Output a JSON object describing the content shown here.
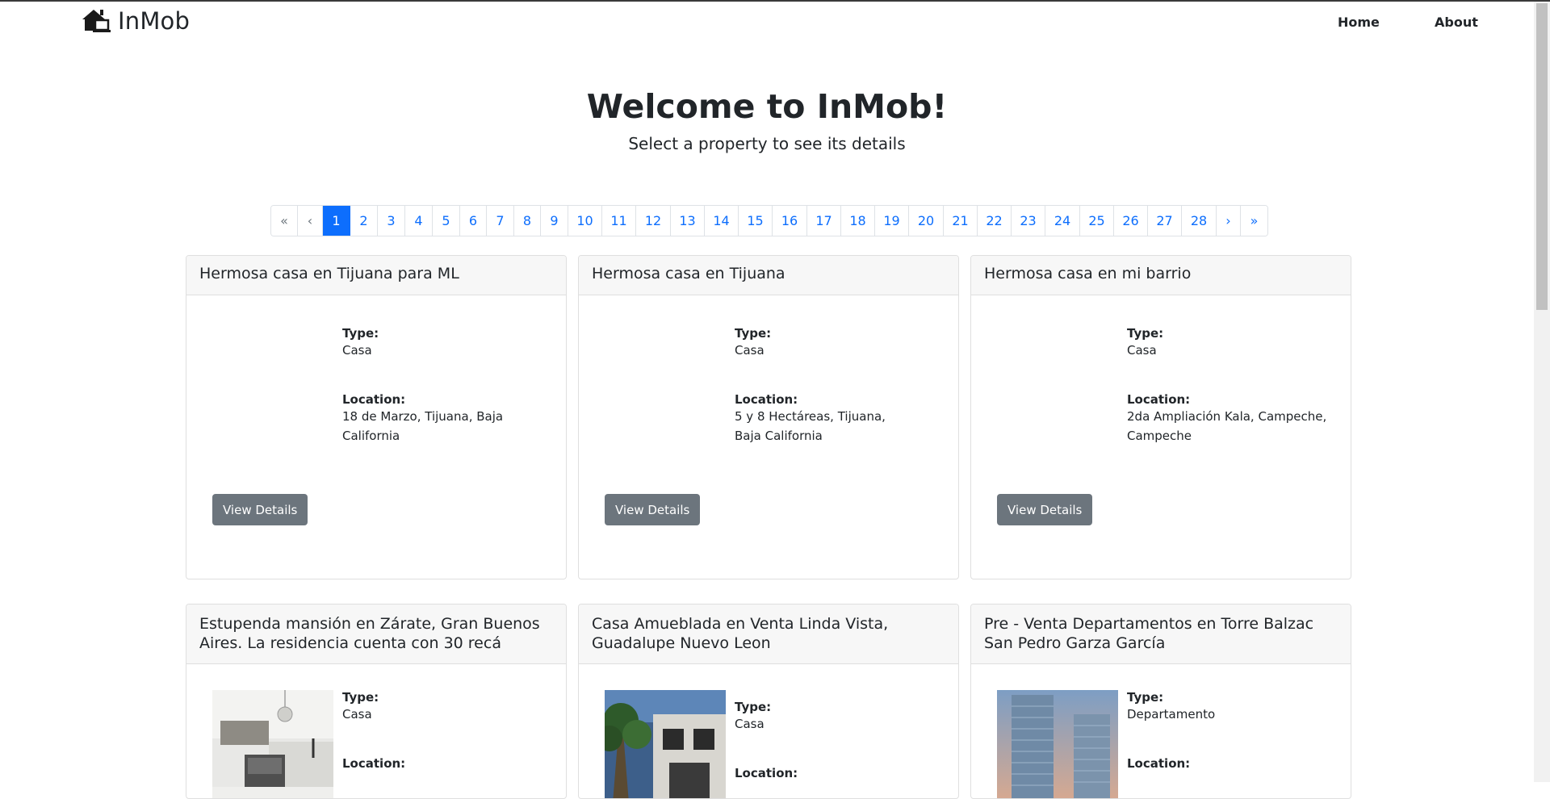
{
  "nav": {
    "brand": "InMob",
    "home": "Home",
    "about": "About"
  },
  "hero": {
    "title": "Welcome to InMob!",
    "subtitle": "Select a property to see its details"
  },
  "pagination": {
    "first": "«",
    "prev": "‹",
    "pages": [
      "1",
      "2",
      "3",
      "4",
      "5",
      "6",
      "7",
      "8",
      "9",
      "10",
      "11",
      "12",
      "13",
      "14",
      "15",
      "16",
      "17",
      "18",
      "19",
      "20",
      "21",
      "22",
      "23",
      "24",
      "25",
      "26",
      "27",
      "28"
    ],
    "next": "›",
    "last": "»",
    "active": "1"
  },
  "labels": {
    "type": "Type:",
    "location": "Location:",
    "view_details": "View Details"
  },
  "properties": [
    {
      "title": "Hermosa casa en Tijuana para ML",
      "type": "Casa",
      "location": "18 de Marzo, Tijuana, Baja California"
    },
    {
      "title": "Hermosa casa en Tijuana",
      "type": "Casa",
      "location": "5 y 8 Hectáreas, Tijuana, Baja California"
    },
    {
      "title": "Hermosa casa en mi barrio",
      "type": "Casa",
      "location": "2da Ampliación Kala, Campeche, Campeche"
    },
    {
      "title": "Estupenda mansión en Zárate, Gran Buenos Aires. La residencia cuenta con 30 recá",
      "type": "Casa",
      "location": ""
    },
    {
      "title": "Casa Amueblada en Venta Linda Vista, Guadalupe Nuevo Leon",
      "type": "Casa",
      "location": ""
    },
    {
      "title": "Pre - Venta Departamentos en Torre Balzac San Pedro Garza García",
      "type": "Departamento",
      "location": ""
    }
  ],
  "colors": {
    "primary": "#0d6efd",
    "secondary_button": "#6c757d",
    "card_header_bg": "#f7f7f7"
  }
}
